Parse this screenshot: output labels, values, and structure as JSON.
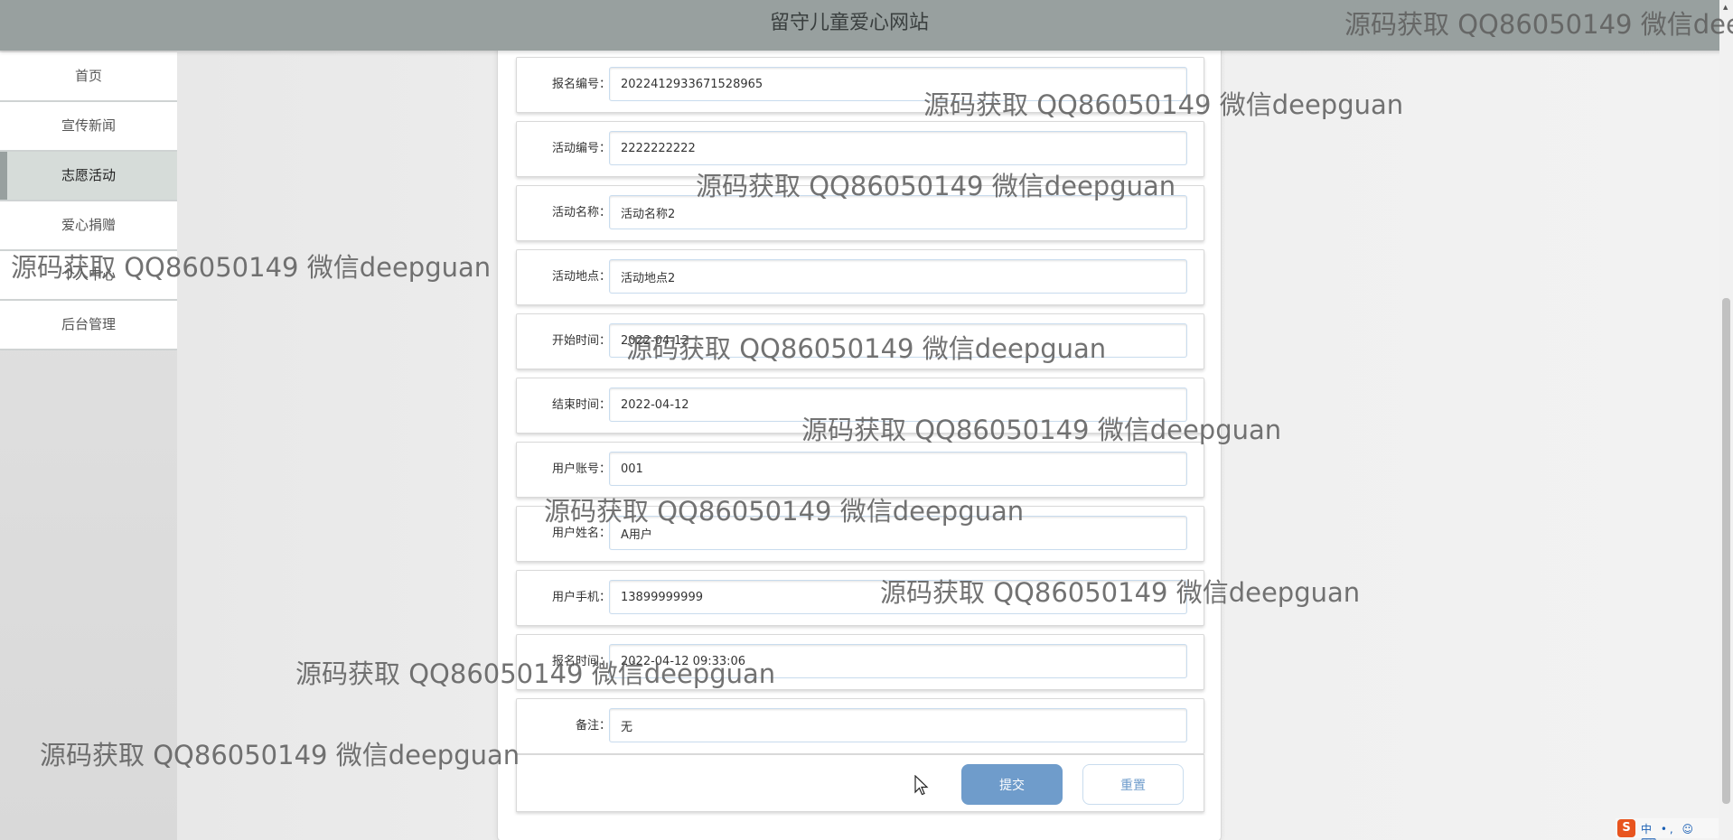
{
  "header": {
    "title": "留守儿童爱心网站"
  },
  "sidebar": {
    "items": [
      {
        "label": "首页",
        "name": "sidebar-item-home",
        "active": false
      },
      {
        "label": "宣传新闻",
        "name": "sidebar-item-news",
        "active": false
      },
      {
        "label": "志愿活动",
        "name": "sidebar-item-volunteer",
        "active": true
      },
      {
        "label": "爱心捐赠",
        "name": "sidebar-item-donation",
        "active": false
      },
      {
        "label": "个人中心",
        "name": "sidebar-item-profile",
        "active": false
      },
      {
        "label": "后台管理",
        "name": "sidebar-item-admin",
        "active": false
      }
    ]
  },
  "form": {
    "fields": [
      {
        "label": "报名编号：",
        "value": "2022412933671528965"
      },
      {
        "label": "活动编号：",
        "value": "2222222222"
      },
      {
        "label": "活动名称：",
        "value": "活动名称2"
      },
      {
        "label": "活动地点：",
        "value": "活动地点2"
      },
      {
        "label": "开始时间：",
        "value": "2022-04-12"
      },
      {
        "label": "结束时间：",
        "value": "2022-04-12"
      },
      {
        "label": "用户账号：",
        "value": "001"
      },
      {
        "label": "用户姓名：",
        "value": "A用户"
      },
      {
        "label": "用户手机：",
        "value": "13899999999"
      },
      {
        "label": "报名时间：",
        "value": "2022-04-12 09:33:06"
      },
      {
        "label": "备注：",
        "value": "无"
      }
    ],
    "submit_label": "提交",
    "reset_label": "重置"
  },
  "watermark": {
    "text": "源码获取 QQ86050149 微信deepguan"
  },
  "ime": {
    "logo": "S",
    "text": "中 •, ☺ ⌨"
  },
  "colors": {
    "header_bg": "#98a09f",
    "accent": "#6f9ccb",
    "active_nav_bg": "#d6dcd9"
  }
}
